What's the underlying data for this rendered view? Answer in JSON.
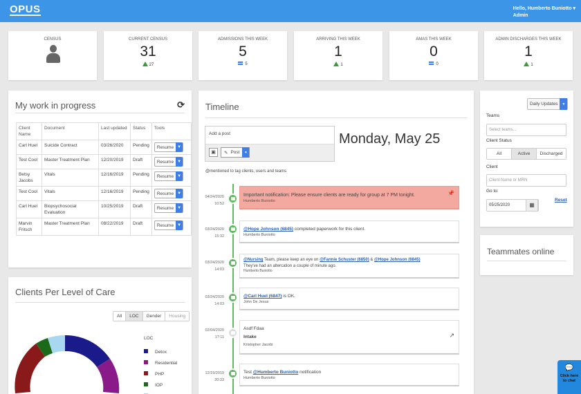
{
  "header": {
    "logo": "OPUS",
    "greeting": "Hello, Humberto Buniotto",
    "role": "Admin"
  },
  "stats": [
    {
      "label": "CENSUS",
      "value": "",
      "change": "",
      "trend": "none"
    },
    {
      "label": "CURRENT CENSUS",
      "value": "31",
      "change": "27",
      "trend": "up"
    },
    {
      "label": "ADMISSIONS THIS WEEK",
      "value": "5",
      "change": "5",
      "trend": "equal"
    },
    {
      "label": "ARRIVING THIS WEEK",
      "value": "1",
      "change": "1",
      "trend": "up"
    },
    {
      "label": "AMAS THIS WEEK",
      "value": "0",
      "change": "0",
      "trend": "equal"
    },
    {
      "label": "ADMIN DISCHARGES THIS WEEK",
      "value": "1",
      "change": "1",
      "trend": "up"
    }
  ],
  "work": {
    "title": "My work in progress",
    "columns": [
      "Client Name",
      "Document",
      "Last updated",
      "Status",
      "Tools"
    ],
    "rows": [
      {
        "client": "Carl Huel",
        "doc": "Suicide Contract",
        "date": "03/26/2020",
        "status": "Pending",
        "tool": "Resume"
      },
      {
        "client": "Test Cool",
        "doc": "Master Treatment Plan",
        "date": "12/20/2019",
        "status": "Draft",
        "tool": "Resume"
      },
      {
        "client": "Betsy Jacobs",
        "doc": "Vitals",
        "date": "12/16/2019",
        "status": "Pending",
        "tool": "Resume"
      },
      {
        "client": "Test Cool",
        "doc": "Vitals",
        "date": "12/16/2019",
        "status": "Pending",
        "tool": "Resume"
      },
      {
        "client": "Carl Huel",
        "doc": "Biopsychosocial Evaluation",
        "date": "10/25/2019",
        "status": "Draft",
        "tool": "Resume"
      },
      {
        "client": "Marvin Fritsch",
        "doc": "Master Treatment Plan",
        "date": "08/22/2019",
        "status": "Draft",
        "tool": "Resume"
      }
    ]
  },
  "loc": {
    "title": "Clients Per Level of Care",
    "filters": [
      "All",
      "LOC",
      "Gender",
      "Housing"
    ],
    "active_filter": "LOC",
    "legend_title": "LOC",
    "legend": [
      {
        "label": "Detox",
        "color": "#1a1a8a"
      },
      {
        "label": "Residential",
        "color": "#8a1a8a"
      },
      {
        "label": "PHP",
        "color": "#8a1a1a"
      },
      {
        "label": "IOP",
        "color": "#1a6a1a"
      },
      {
        "label": "OP",
        "color": "#a8d8f0"
      }
    ]
  },
  "timeline": {
    "title": "Timeline",
    "add_post": "Add a post",
    "post_btn": "Post",
    "hint": "@mentioned to tag clients, users and teams",
    "date_heading": "Monday, May 25",
    "items": [
      {
        "date": "04/24/2020",
        "time": "10:52",
        "text": "Important notification: Please ensure clients are ready for group at 7 PM tonight.",
        "author": "Humberto Buniotto"
      },
      {
        "date": "03/24/2020",
        "time": "15:32",
        "mention": "@Hope Johnson (6845)",
        "text": " completed paperwork for this client.",
        "author": "Humberto Buniotto"
      },
      {
        "date": "03/24/2020",
        "time": "14:03",
        "mention": "@Nursing",
        "text": " Team, please keep an eye on ",
        "mention2": "@Fannie Schuster (6850)",
        "text2": " & ",
        "mention3": "@Hope Johnson (6845)",
        "line2": "They've had an altercation a couple of minute ago.",
        "author": "Humberto Buniotto"
      },
      {
        "date": "03/24/2020",
        "time": "14:03",
        "mention": "@Carl Huel (6847)",
        "text": " is OK.",
        "author": "John De Jesus"
      },
      {
        "date": "02/04/2020",
        "time": "17:11",
        "title": "Asdf Fdaa",
        "subtitle": "Intake",
        "author": "Kristopher Jacobi"
      },
      {
        "date": "12/19/2019",
        "time": "20:33",
        "text": "Test ",
        "mention": "@Humberto Buniotto",
        "text_after": " notification",
        "author": "Humberto Buniotto"
      }
    ]
  },
  "filters": {
    "updates": "Daily Updates",
    "teams_label": "Teams",
    "teams_placeholder": "Select teams...",
    "status_label": "Client Status",
    "status_options": [
      "All",
      "Active",
      "Discharged"
    ],
    "client_label": "Client",
    "client_placeholder": "Client Name or MRN",
    "goto_label": "Go to:",
    "goto_value": "05/25/2020",
    "reset": "Reset"
  },
  "teammates": {
    "title": "Teammates online"
  },
  "chat": {
    "label": "Click here to chat"
  }
}
